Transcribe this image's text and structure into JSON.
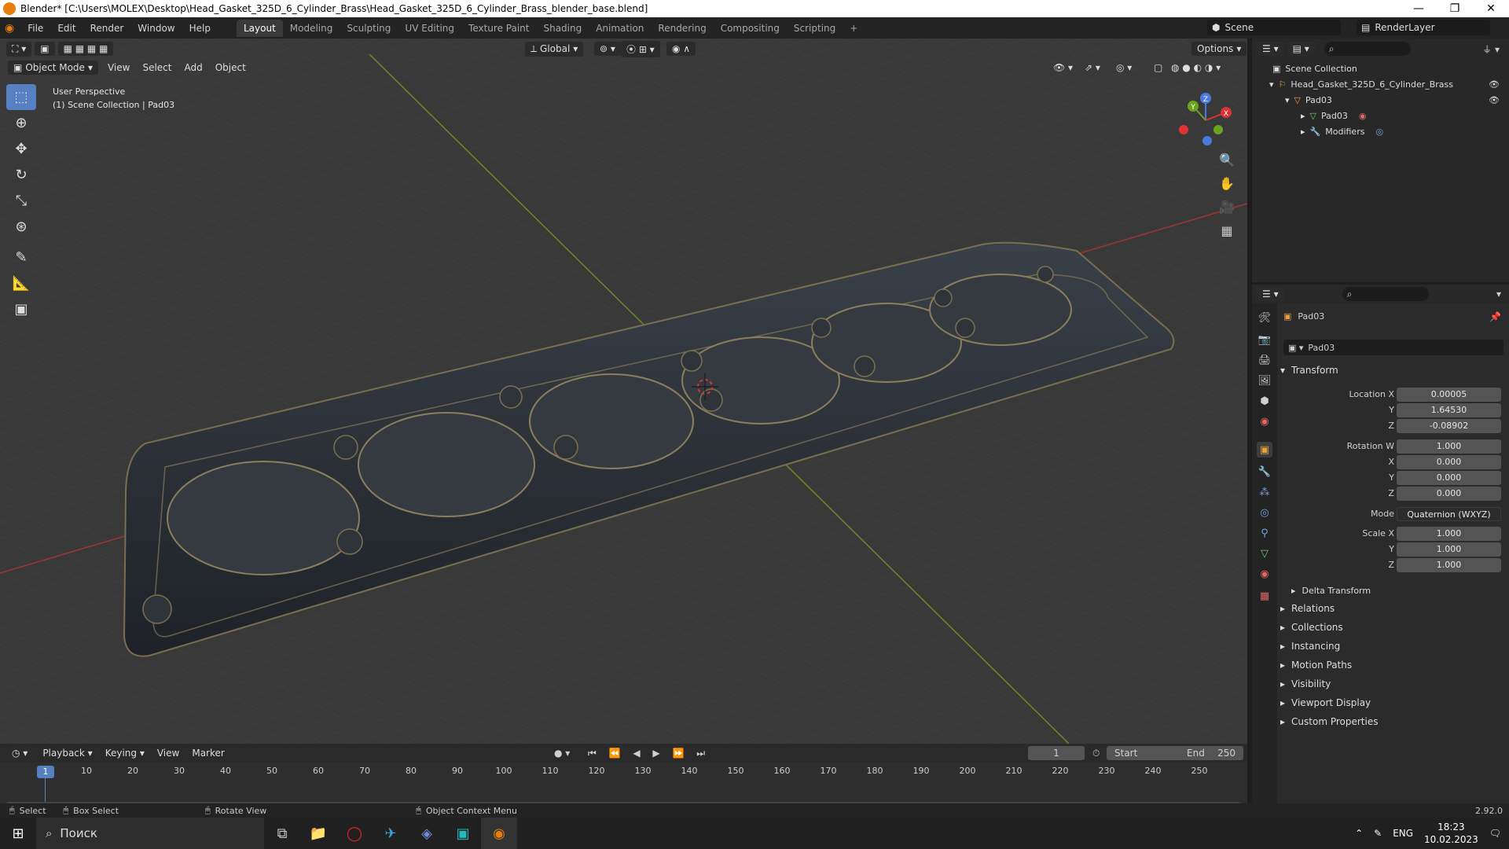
{
  "window": {
    "title": "Blender* [C:\\Users\\MOLEX\\Desktop\\Head_Gasket_325D_6_Cylinder_Brass\\Head_Gasket_325D_6_Cylinder_Brass_blender_base.blend]"
  },
  "menu": [
    "File",
    "Edit",
    "Render",
    "Window",
    "Help"
  ],
  "workspaces": [
    "Layout",
    "Modeling",
    "Sculpting",
    "UV Editing",
    "Texture Paint",
    "Shading",
    "Animation",
    "Rendering",
    "Compositing",
    "Scripting"
  ],
  "scene": {
    "name": "Scene",
    "view_layer": "RenderLayer"
  },
  "viewport": {
    "orientation": "Global",
    "options_label": "Options",
    "mode": "Object Mode",
    "menus": [
      "View",
      "Select",
      "Add",
      "Object"
    ],
    "overlay_title": "User Perspective",
    "overlay_sub": "(1) Scene Collection | Pad03",
    "gizmo": {
      "x": "X",
      "y": "Y",
      "z": "Z"
    }
  },
  "outliner": {
    "root": "Scene Collection",
    "items": [
      {
        "label": "Head_Gasket_325D_6_Cylinder_Brass"
      },
      {
        "label": "Pad03"
      },
      {
        "label": "Pad03"
      },
      {
        "label": "Modifiers"
      }
    ]
  },
  "properties": {
    "object_name": "Pad03",
    "datablock": "Pad03",
    "transform_label": "Transform",
    "location": {
      "label": "Location X",
      "x": "0.00005",
      "y": "1.64530",
      "z": "-0.08902"
    },
    "rotation": {
      "label": "Rotation W",
      "w": "1.000",
      "x": "0.000",
      "y": "0.000",
      "z": "0.000"
    },
    "mode": {
      "label": "Mode",
      "value": "Quaternion (WXYZ)"
    },
    "scale": {
      "label": "Scale X",
      "x": "1.000",
      "y": "1.000",
      "z": "1.000"
    },
    "axis": {
      "y": "Y",
      "z": "Z"
    },
    "sub_panel": "Delta Transform",
    "panels": [
      "Relations",
      "Collections",
      "Instancing",
      "Motion Paths",
      "Visibility",
      "Viewport Display",
      "Custom Properties"
    ]
  },
  "timeline": {
    "menus": [
      "Playback",
      "Keying",
      "View",
      "Marker"
    ],
    "current_frame": "1",
    "start_label": "Start",
    "start": "1",
    "end_label": "End",
    "end": "250",
    "ticks": [
      "10",
      "20",
      "30",
      "40",
      "50",
      "60",
      "70",
      "80",
      "90",
      "100",
      "110",
      "120",
      "130",
      "140",
      "150",
      "160",
      "170",
      "180",
      "190",
      "200",
      "210",
      "220",
      "230",
      "240",
      "250"
    ]
  },
  "status": {
    "select": "Select",
    "box_select": "Box Select",
    "rotate": "Rotate View",
    "context": "Object Context Menu",
    "version": "2.92.0"
  },
  "taskbar": {
    "search": "Поиск",
    "lang": "ENG",
    "time": "18:23",
    "date": "10.02.2023"
  }
}
